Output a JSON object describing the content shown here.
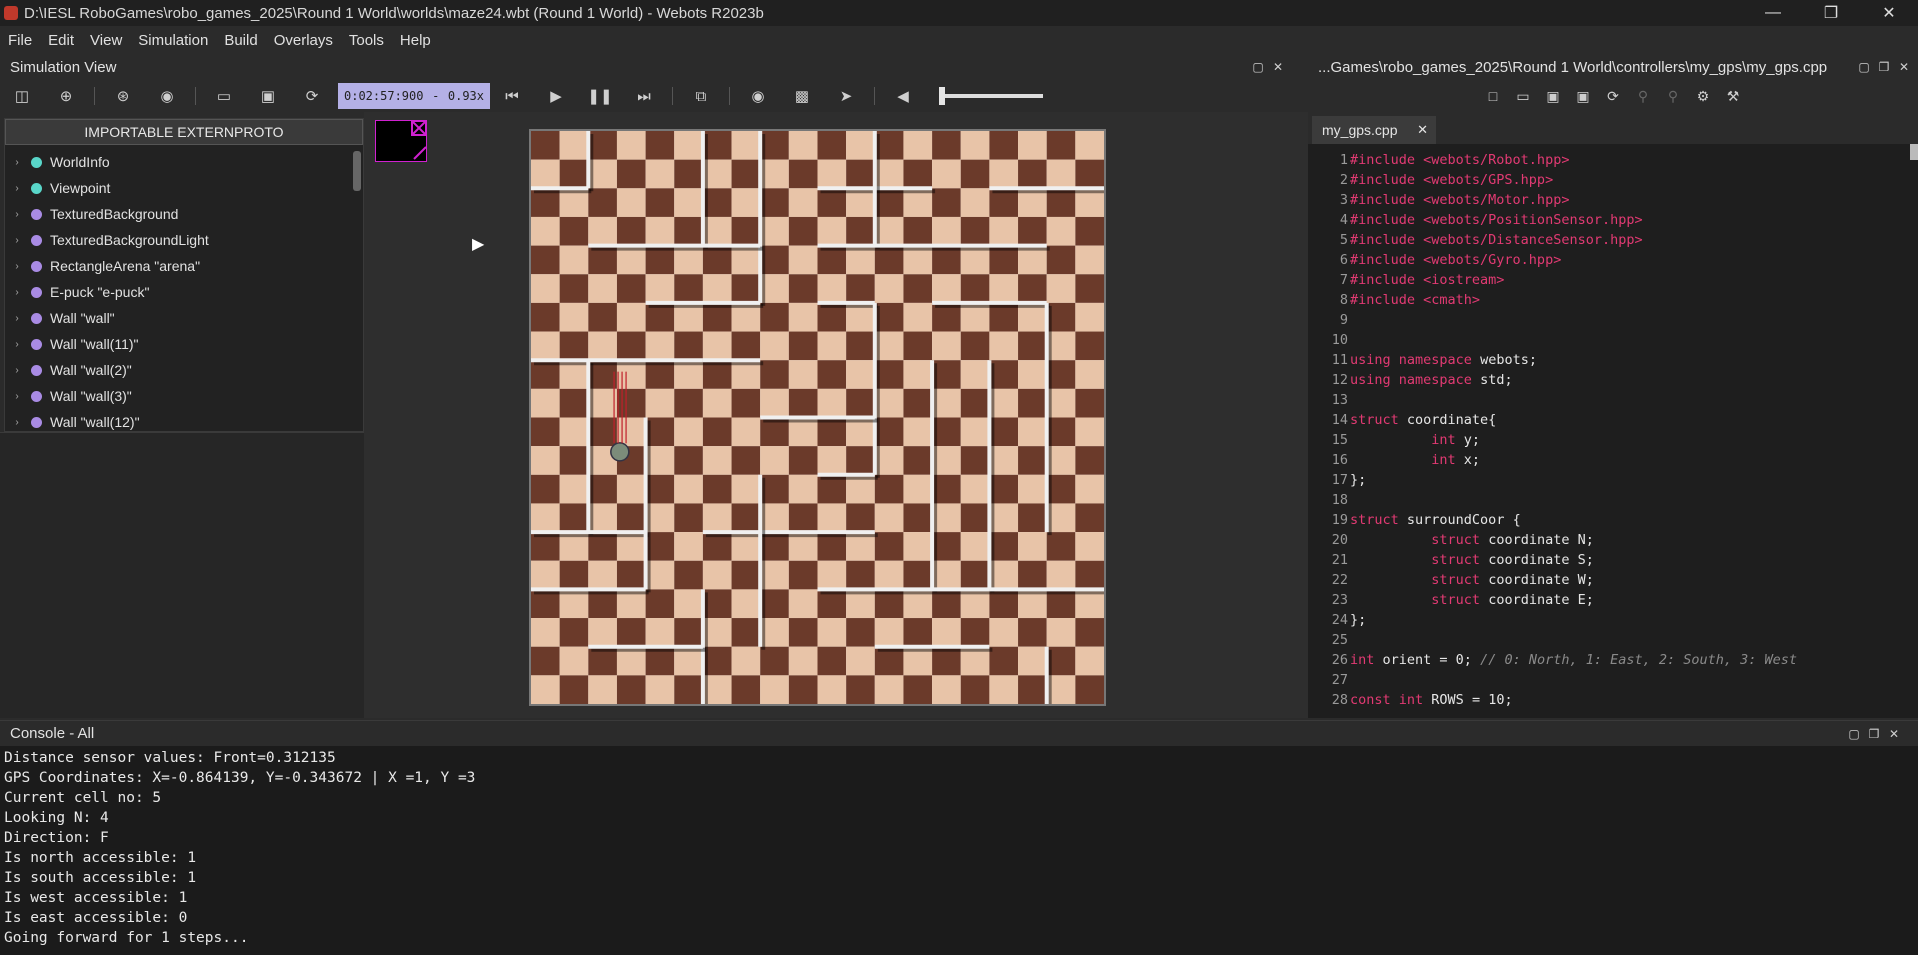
{
  "window": {
    "title": "D:\\IESL RoboGames\\robo_games_2025\\Round 1 World\\worlds\\maze24.wbt (Round 1 World) - Webots R2023b"
  },
  "menu": [
    "File",
    "Edit",
    "View",
    "Simulation",
    "Build",
    "Overlays",
    "Tools",
    "Help"
  ],
  "simulation_view": {
    "title": "Simulation View",
    "time": "0:02:57:900",
    "speed": "0.93x"
  },
  "scene_tree": {
    "proto_button": "IMPORTABLE EXTERNPROTO",
    "items": [
      {
        "label": "WorldInfo",
        "color": "#59d6c9"
      },
      {
        "label": "Viewpoint",
        "color": "#59d6c9"
      },
      {
        "label": "TexturedBackground",
        "color": "#a98be4"
      },
      {
        "label": "TexturedBackgroundLight",
        "color": "#a98be4"
      },
      {
        "label": "RectangleArena \"arena\"",
        "color": "#a98be4"
      },
      {
        "label": "E-puck \"e-puck\"",
        "color": "#a98be4"
      },
      {
        "label": "Wall \"wall\"",
        "color": "#a98be4"
      },
      {
        "label": "Wall \"wall(11)\"",
        "color": "#a98be4"
      },
      {
        "label": "Wall \"wall(2)\"",
        "color": "#a98be4"
      },
      {
        "label": "Wall \"wall(3)\"",
        "color": "#a98be4"
      },
      {
        "label": "Wall \"wall(12)\"",
        "color": "#a98be4"
      }
    ]
  },
  "editor": {
    "path": "...Games\\robo_games_2025\\Round 1 World\\controllers\\my_gps\\my_gps.cpp",
    "tab": "my_gps.cpp",
    "lines": [
      {
        "n": "1",
        "t": "#include <webots/Robot.hpp>",
        "k": "inc"
      },
      {
        "n": "2",
        "t": "#include <webots/GPS.hpp>",
        "k": "inc"
      },
      {
        "n": "3",
        "t": "#include <webots/Motor.hpp>",
        "k": "inc"
      },
      {
        "n": "4",
        "t": "#include <webots/PositionSensor.hpp>",
        "k": "inc"
      },
      {
        "n": "5",
        "t": "#include <webots/DistanceSensor.hpp>",
        "k": "inc"
      },
      {
        "n": "6",
        "t": "#include <webots/Gyro.hpp>",
        "k": "inc"
      },
      {
        "n": "7",
        "t": "#include <iostream>",
        "k": "inc"
      },
      {
        "n": "8",
        "t": "#include <cmath>",
        "k": "inc"
      },
      {
        "n": "9",
        "t": "",
        "k": "ct"
      },
      {
        "n": "10",
        "t": "",
        "k": "ct"
      },
      {
        "n": "11",
        "t": "using namespace webots;",
        "k": "ct"
      },
      {
        "n": "12",
        "t": "using namespace std;",
        "k": "ct"
      },
      {
        "n": "13",
        "t": "",
        "k": "ct"
      },
      {
        "n": "14",
        "t": "struct coordinate{",
        "k": "ct"
      },
      {
        "n": "15",
        "t": "          int y;",
        "k": "ct"
      },
      {
        "n": "16",
        "t": "          int x;",
        "k": "ct"
      },
      {
        "n": "17",
        "t": "};",
        "k": "ct"
      },
      {
        "n": "18",
        "t": "",
        "k": "ct"
      },
      {
        "n": "19",
        "t": "struct surroundCoor {",
        "k": "ct"
      },
      {
        "n": "20",
        "t": "          struct coordinate N;",
        "k": "ct"
      },
      {
        "n": "21",
        "t": "          struct coordinate S;",
        "k": "ct"
      },
      {
        "n": "22",
        "t": "          struct coordinate W;",
        "k": "ct"
      },
      {
        "n": "23",
        "t": "          struct coordinate E;",
        "k": "ct"
      },
      {
        "n": "24",
        "t": "};",
        "k": "ct"
      },
      {
        "n": "25",
        "t": "",
        "k": "ct"
      },
      {
        "n": "26",
        "t": "int orient = 0; // 0: North, 1: East, 2: South, 3: West",
        "k": "ct"
      },
      {
        "n": "27",
        "t": "",
        "k": "ct"
      },
      {
        "n": "28",
        "t": "const int ROWS = 10;",
        "k": "ct"
      }
    ]
  },
  "console": {
    "title": "Console - All",
    "lines": [
      "Distance sensor values: Front=0.312135",
      "GPS Coordinates: X=-0.864139, Y=-0.343672 | X =1, Y =3",
      "Current cell no: 5",
      "Looking N: 4",
      "Direction: F",
      "Is north accessible: 1",
      "Is south accessible: 1",
      "Is west accessible: 1",
      "Is east accessible: 0",
      "Going forward for 1 steps..."
    ]
  },
  "icons": [
    "app-icon",
    "minimize-icon",
    "maximize-icon",
    "close-icon",
    "undock-icon",
    "float-icon",
    "new-icon",
    "open-icon",
    "save-icon",
    "reload-icon",
    "step-back-icon",
    "play-icon",
    "pause-icon",
    "fast-forward-icon",
    "camera-icon",
    "share-icon",
    "volume-icon",
    "settings-icon",
    "hammer-icon"
  ]
}
